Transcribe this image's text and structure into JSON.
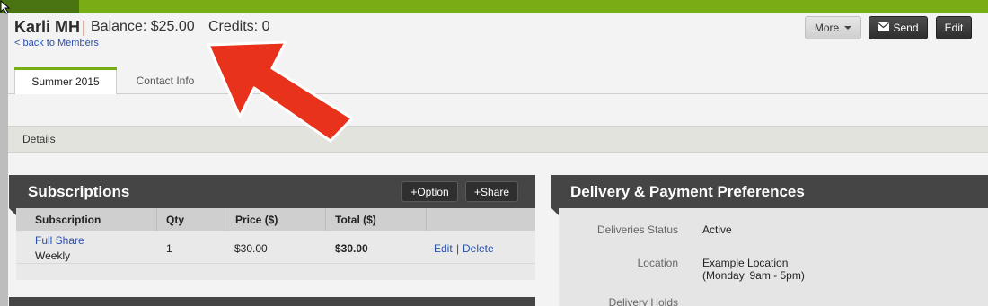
{
  "header": {
    "member_name": "Karli MH",
    "separator": "|",
    "balance": "Balance: $25.00",
    "credits": "Credits: 0",
    "back_link": "< back to Members"
  },
  "actions": {
    "more": "More",
    "send": "Send",
    "edit": "Edit"
  },
  "tabs": [
    {
      "label": "Summer 2015",
      "active": true
    },
    {
      "label": "Contact Info",
      "active": false
    }
  ],
  "details_bar": "Details",
  "subscriptions": {
    "title": "Subscriptions",
    "add_option": "+Option",
    "add_share": "+Share",
    "columns": [
      "Subscription",
      "Qty",
      "Price ($)",
      "Total ($)"
    ],
    "rows": [
      {
        "name": "Full Share",
        "frequency": "Weekly",
        "qty": "1",
        "price": "$30.00",
        "total": "$30.00",
        "edit": "Edit",
        "separator": "|",
        "delete": "Delete"
      }
    ]
  },
  "delivery": {
    "title": "Delivery & Payment Preferences",
    "fields": [
      {
        "label": "Deliveries Status",
        "value": "Active"
      },
      {
        "label": "Location",
        "value": "Example Location",
        "sub": "(Monday, 9am - 5pm)"
      },
      {
        "label": "Delivery Holds",
        "value": ""
      }
    ]
  },
  "colors": {
    "brand_green": "#78ad14",
    "panel_dark": "#454545",
    "link_blue": "#2b4fa8",
    "annotation_arrow": "#e8321b"
  },
  "icons": [
    "envelope-icon",
    "caret-down-icon",
    "cursor-icon",
    "annotation-arrow-icon"
  ]
}
